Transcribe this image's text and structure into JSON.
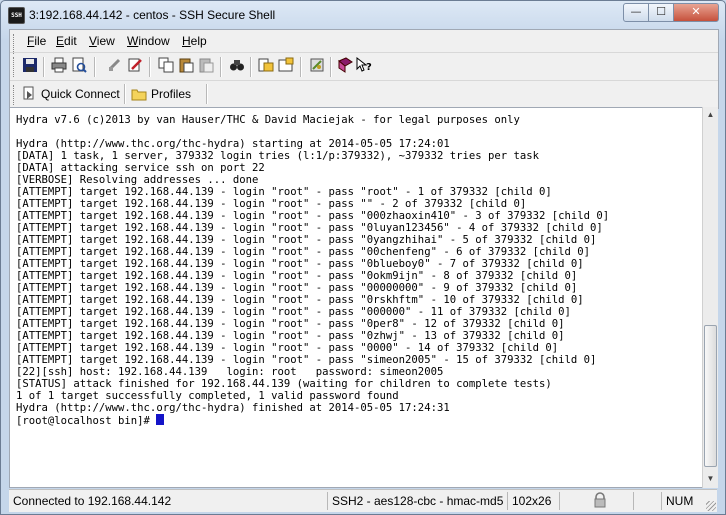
{
  "window": {
    "title": "3:192.168.44.142 - centos - SSH Secure Shell",
    "app_icon_text": "SSH",
    "minimize_symbol": "—",
    "maximize_symbol": "☐",
    "close_symbol": "✕"
  },
  "menu": [
    {
      "accel": "F",
      "rest": "ile"
    },
    {
      "accel": "E",
      "rest": "dit"
    },
    {
      "accel": "V",
      "rest": "iew"
    },
    {
      "accel": "W",
      "rest": "indow"
    },
    {
      "accel": "H",
      "rest": "elp"
    }
  ],
  "toolbar_icons": [
    "save",
    "print",
    "print-preview",
    "disconnect",
    "settings",
    "copy",
    "paste",
    "paste-gray",
    "find",
    "file-transfer",
    "new-window",
    "preferences",
    "help-book",
    "context-help"
  ],
  "profile_bar": {
    "quick_connect": "Quick Connect",
    "profiles": "Profiles"
  },
  "terminal": {
    "lines": [
      "Hydra v7.6 (c)2013 by van Hauser/THC & David Maciejak - for legal purposes only",
      "",
      "Hydra (http://www.thc.org/thc-hydra) starting at 2014-05-05 17:24:01",
      "[DATA] 1 task, 1 server, 379332 login tries (l:1/p:379332), ~379332 tries per task",
      "[DATA] attacking service ssh on port 22",
      "[VERBOSE] Resolving addresses ... done",
      "[ATTEMPT] target 192.168.44.139 - login \"root\" - pass \"root\" - 1 of 379332 [child 0]",
      "[ATTEMPT] target 192.168.44.139 - login \"root\" - pass \"\" - 2 of 379332 [child 0]",
      "[ATTEMPT] target 192.168.44.139 - login \"root\" - pass \"000zhaoxin410\" - 3 of 379332 [child 0]",
      "[ATTEMPT] target 192.168.44.139 - login \"root\" - pass \"0luyan123456\" - 4 of 379332 [child 0]",
      "[ATTEMPT] target 192.168.44.139 - login \"root\" - pass \"0yangzhihai\" - 5 of 379332 [child 0]",
      "[ATTEMPT] target 192.168.44.139 - login \"root\" - pass \"00chenfeng\" - 6 of 379332 [child 0]",
      "[ATTEMPT] target 192.168.44.139 - login \"root\" - pass \"0blueboy0\" - 7 of 379332 [child 0]",
      "[ATTEMPT] target 192.168.44.139 - login \"root\" - pass \"0okm9ijn\" - 8 of 379332 [child 0]",
      "[ATTEMPT] target 192.168.44.139 - login \"root\" - pass \"00000000\" - 9 of 379332 [child 0]",
      "[ATTEMPT] target 192.168.44.139 - login \"root\" - pass \"0rskhftm\" - 10 of 379332 [child 0]",
      "[ATTEMPT] target 192.168.44.139 - login \"root\" - pass \"000000\" - 11 of 379332 [child 0]",
      "[ATTEMPT] target 192.168.44.139 - login \"root\" - pass \"0per8\" - 12 of 379332 [child 0]",
      "[ATTEMPT] target 192.168.44.139 - login \"root\" - pass \"0zhwj\" - 13 of 379332 [child 0]",
      "[ATTEMPT] target 192.168.44.139 - login \"root\" - pass \"0000\" - 14 of 379332 [child 0]",
      "[ATTEMPT] target 192.168.44.139 - login \"root\" - pass \"simeon2005\" - 15 of 379332 [child 0]",
      "[22][ssh] host: 192.168.44.139   login: root   password: simeon2005",
      "[STATUS] attack finished for 192.168.44.139 (waiting for children to complete tests)",
      "1 of 1 target successfully completed, 1 valid password found",
      "Hydra (http://www.thc.org/thc-hydra) finished at 2014-05-05 17:24:31"
    ],
    "prompt": "[root@localhost bin]# ",
    "cursor_color": "#1414c8"
  },
  "status": {
    "connection": "Connected to 192.168.44.142",
    "cipher": "SSH2 - aes128-cbc - hmac-md5",
    "size": "102x26",
    "num": "NUM"
  }
}
